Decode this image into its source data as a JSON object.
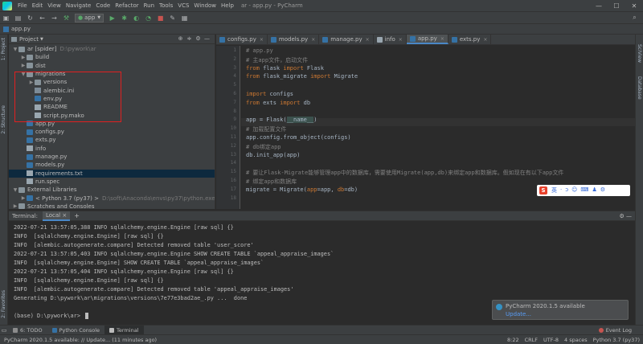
{
  "window": {
    "title": "ar - app.py - PyCharm",
    "min": "—",
    "max": "☐",
    "close": "✕"
  },
  "menu": [
    "File",
    "Edit",
    "View",
    "Navigate",
    "Code",
    "Refactor",
    "Run",
    "Tools",
    "VCS",
    "Window",
    "Help"
  ],
  "toolbar": {
    "run_config": "app"
  },
  "navbar": {
    "file": "app.py"
  },
  "side_tabs": {
    "project": "1: Project",
    "structure": "2: Structure",
    "favorites": "2: Favorites",
    "sciview": "SciView",
    "database": "Database"
  },
  "project": {
    "title": "Project",
    "rows": [
      {
        "arrow": "▼",
        "icon": "fold",
        "name": "ar [spider]",
        "dim": "D:\\pywork\\ar"
      },
      {
        "arrow": "▶",
        "icon": "fold",
        "name": "build",
        "dim": ""
      },
      {
        "arrow": "▶",
        "icon": "fold",
        "name": "dist",
        "dim": ""
      },
      {
        "arrow": "▼",
        "icon": "fold",
        "name": "migrations",
        "dim": ""
      },
      {
        "arrow": "▶",
        "icon": "fold",
        "name": "versions",
        "dim": ""
      },
      {
        "arrow": "",
        "icon": "fini",
        "name": "alembic.ini",
        "dim": ""
      },
      {
        "arrow": "",
        "icon": "fpy",
        "name": "env.py",
        "dim": ""
      },
      {
        "arrow": "",
        "icon": "ftxt",
        "name": "README",
        "dim": ""
      },
      {
        "arrow": "",
        "icon": "ftxt",
        "name": "script.py.mako",
        "dim": ""
      },
      {
        "arrow": "",
        "icon": "fpy",
        "name": "app.py",
        "dim": ""
      },
      {
        "arrow": "",
        "icon": "fpy",
        "name": "configs.py",
        "dim": ""
      },
      {
        "arrow": "",
        "icon": "fpy",
        "name": "exts.py",
        "dim": ""
      },
      {
        "arrow": "",
        "icon": "ftxt",
        "name": "info",
        "dim": ""
      },
      {
        "arrow": "",
        "icon": "fpy",
        "name": "manage.py",
        "dim": ""
      },
      {
        "arrow": "",
        "icon": "fpy",
        "name": "models.py",
        "dim": ""
      },
      {
        "arrow": "",
        "icon": "ftxt",
        "name": "requirements.txt",
        "dim": ""
      },
      {
        "arrow": "",
        "icon": "ftxt",
        "name": "run.spec",
        "dim": ""
      },
      {
        "arrow": "▼",
        "icon": "fold",
        "name": "External Libraries",
        "dim": ""
      },
      {
        "arrow": "▶",
        "icon": "fpy",
        "name": "< Python 3.7 (py37) >",
        "dim": "D:\\soft\\Anaconda\\envs\\py37\\python.exe"
      },
      {
        "arrow": "▶",
        "icon": "fold",
        "name": "Scratches and Consoles",
        "dim": ""
      }
    ],
    "indent": [
      0,
      1,
      1,
      1,
      2,
      2,
      2,
      2,
      2,
      1,
      1,
      1,
      1,
      1,
      1,
      1,
      1,
      0,
      1,
      0
    ],
    "selected_row": 15
  },
  "tabs": [
    {
      "name": "configs.py",
      "color": "#3572a5",
      "active": false
    },
    {
      "name": "models.py",
      "color": "#3572a5",
      "active": false
    },
    {
      "name": "manage.py",
      "color": "#3572a5",
      "active": false
    },
    {
      "name": "info",
      "color": "#9aa7b0",
      "active": false
    },
    {
      "name": "app.py",
      "color": "#3572a5",
      "active": true
    },
    {
      "name": "exts.py",
      "color": "#3572a5",
      "active": false
    }
  ],
  "tab_close": "×",
  "code": [
    "# app.py",
    "# 主app文件，启动文件",
    "from flask import Flask",
    "from flask_migrate import Migrate",
    "",
    "import configs",
    "from exts import db",
    "",
    "app = Flask(__name__)",
    "# 加载配置文件",
    "app.config.from_object(configs)",
    "# db绑定app",
    "db.init_app(app)",
    "",
    "# 要让Flask-Migrate能够管理app中的数据库，需要使用Migrate(app,db)来绑定app和数据库。假如现在有以下app文件",
    "# 绑定app和数据库",
    "migrate = Migrate(app=app, db=db)"
  ],
  "gutter_lines": [
    "1",
    "2",
    "3",
    "4",
    "5",
    "6",
    "7",
    "8",
    "9",
    "10",
    "11",
    "12",
    "13",
    "14",
    "15",
    "16",
    "17",
    "18"
  ],
  "ime": {
    "logo": "S",
    "items": [
      "英",
      "·",
      "ↄ",
      "☺",
      "⌨",
      "♟",
      "⚙"
    ]
  },
  "terminal": {
    "title": "Terminal:",
    "local_tab": "Local",
    "close": "×",
    "plus": "+",
    "lines": [
      "2022-07-21 13:57:05,388 INFO sqlalchemy.engine.Engine [raw sql] {}",
      "INFO  [sqlalchemy.engine.Engine] [raw sql] {}",
      "INFO  [alembic.autogenerate.compare] Detected removed table 'user_score'",
      "2022-07-21 13:57:05,403 INFO sqlalchemy.engine.Engine SHOW CREATE TABLE `appeal_appraise_images`",
      "INFO  [sqlalchemy.engine.Engine] SHOW CREATE TABLE `appeal_appraise_images`",
      "2022-07-21 13:57:05,404 INFO sqlalchemy.engine.Engine [raw sql] {}",
      "INFO  [sqlalchemy.engine.Engine] [raw sql] {}",
      "INFO  [alembic.autogenerate.compare] Detected removed table 'appeal_appraise_images'",
      "Generating D:\\pywork\\ar\\migrations\\versions\\7e77e3bad2ae_.py ...  done",
      "",
      "(base) D:\\pywork\\ar>"
    ]
  },
  "notification": {
    "title": "PyCharm 2020.1.5 available",
    "link": "Update..."
  },
  "bottom_tabs": [
    {
      "label": "6: TODO",
      "color": "#8c8c8c"
    },
    {
      "label": "Python Console",
      "color": "#3572a5"
    },
    {
      "label": "Terminal",
      "color": "#bbbbbb",
      "active": true
    }
  ],
  "event_log": "Event Log",
  "status": {
    "message": "PyCharm 2020.1.5 available: // Update... (11 minutes ago)",
    "right": [
      "8:22",
      "CRLF",
      "UTF-8",
      "4 spaces",
      "Python 3.7 (py37)"
    ]
  }
}
